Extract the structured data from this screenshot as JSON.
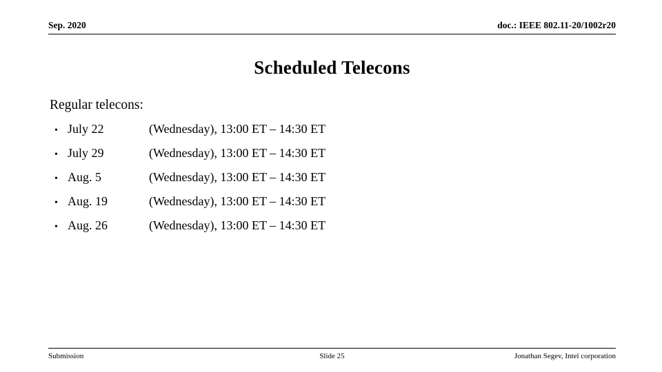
{
  "header": {
    "date": "Sep. 2020",
    "doc_reference": "doc.: IEEE 802.11-20/1002r20"
  },
  "title": "Scheduled Telecons",
  "body": {
    "heading": "Regular telecons:",
    "bullet_glyph": "•",
    "rows": [
      {
        "date": "July 22",
        "detail": "(Wednesday), 13:00 ET – 14:30 ET"
      },
      {
        "date": "July 29",
        "detail": "(Wednesday), 13:00 ET – 14:30 ET"
      },
      {
        "date": "Aug. 5",
        "detail": "(Wednesday), 13:00 ET – 14:30 ET"
      },
      {
        "date": "Aug. 19",
        "detail": "(Wednesday), 13:00 ET – 14:30 ET"
      },
      {
        "date": "Aug. 26",
        "detail": "(Wednesday), 13:00 ET – 14:30 ET"
      }
    ]
  },
  "footer": {
    "left": "Submission",
    "center": "Slide 25",
    "right": "Jonathan Segev, Intel corporation"
  },
  "colors": {
    "text": "#000000",
    "background": "#ffffff",
    "rule": "#000000"
  }
}
